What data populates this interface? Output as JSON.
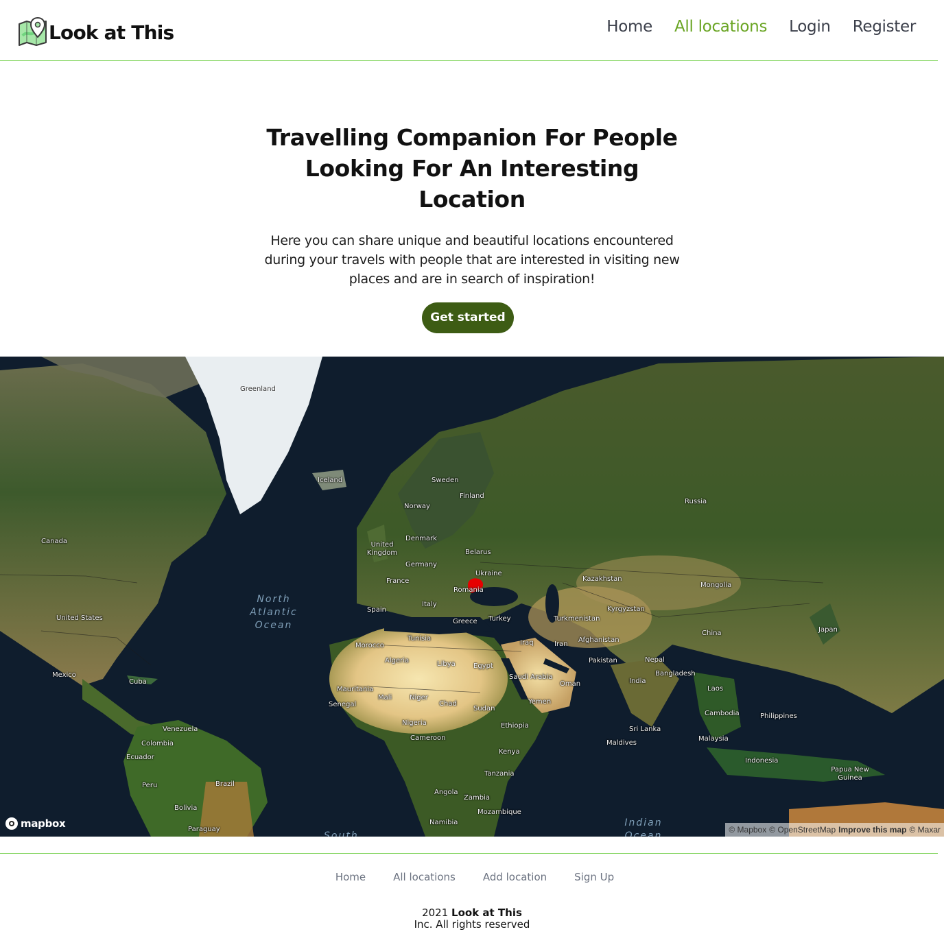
{
  "header": {
    "brand": "Look at This",
    "logo_icon": "map-icon",
    "nav": [
      {
        "label": "Home",
        "active": false
      },
      {
        "label": "All locations",
        "active": true
      },
      {
        "label": "Login",
        "active": false
      },
      {
        "label": "Register",
        "active": false
      }
    ]
  },
  "hero": {
    "title": "Travelling Companion For People Looking For An Interesting Location",
    "description": "Here you can share unique and beautiful locations encountered during your travels with people that are interested in visiting new places and are in search of inspiration!",
    "cta_label": "Get started"
  },
  "map": {
    "countries": [
      "Greenland",
      "Iceland",
      "Sweden",
      "Finland",
      "Norway",
      "Russia",
      "Canada",
      "Denmark",
      "United Kingdom",
      "Belarus",
      "Germany",
      "Ukraine",
      "France",
      "Kazakhstan",
      "Romania",
      "Mongolia",
      "Italy",
      "Spain",
      "Kyrgyzstan",
      "United States",
      "Greece",
      "Turkey",
      "Turkmenistan",
      "Tunisia",
      "Morocco",
      "Iraq",
      "Iran",
      "Afghanistan",
      "China",
      "Japan",
      "Algeria",
      "Libya",
      "Egypt",
      "Pakistan",
      "Nepal",
      "Mexico",
      "Cuba",
      "Saudi Arabia",
      "Bangladesh",
      "India",
      "Oman",
      "Mauritania",
      "Mali",
      "Niger",
      "Senegal",
      "Chad",
      "Laos",
      "Yemen",
      "Sudan",
      "Venezuela",
      "Nigeria",
      "Ethiopia",
      "Sri Lanka",
      "Cambodia",
      "Philippines",
      "Colombia",
      "Cameroon",
      "Malaysia",
      "Maldives",
      "Ecuador",
      "Kenya",
      "Indonesia",
      "Tanzania",
      "Papua New Guinea",
      "Peru",
      "Brazil",
      "Angola",
      "Zambia",
      "Bolivia",
      "Mozambique",
      "Namibia",
      "Paraguay"
    ],
    "oceans": [
      "North Atlantic Ocean",
      "Indian Ocean",
      "South"
    ],
    "marker_color": "#e60000",
    "mapbox_label": "mapbox",
    "attribution": {
      "mapbox": "© Mapbox",
      "osm": "© OpenStreetMap",
      "improve": "Improve this map",
      "maxar": "© Maxar"
    }
  },
  "footer": {
    "nav": [
      "Home",
      "All locations",
      "Add location",
      "Sign Up"
    ],
    "year": "2021",
    "brand": "Look at This",
    "rights": "Inc. All rights reserved"
  },
  "colors": {
    "accent": "#6aa524",
    "cta": "#3d5c14",
    "divider": "#7fd45a"
  }
}
